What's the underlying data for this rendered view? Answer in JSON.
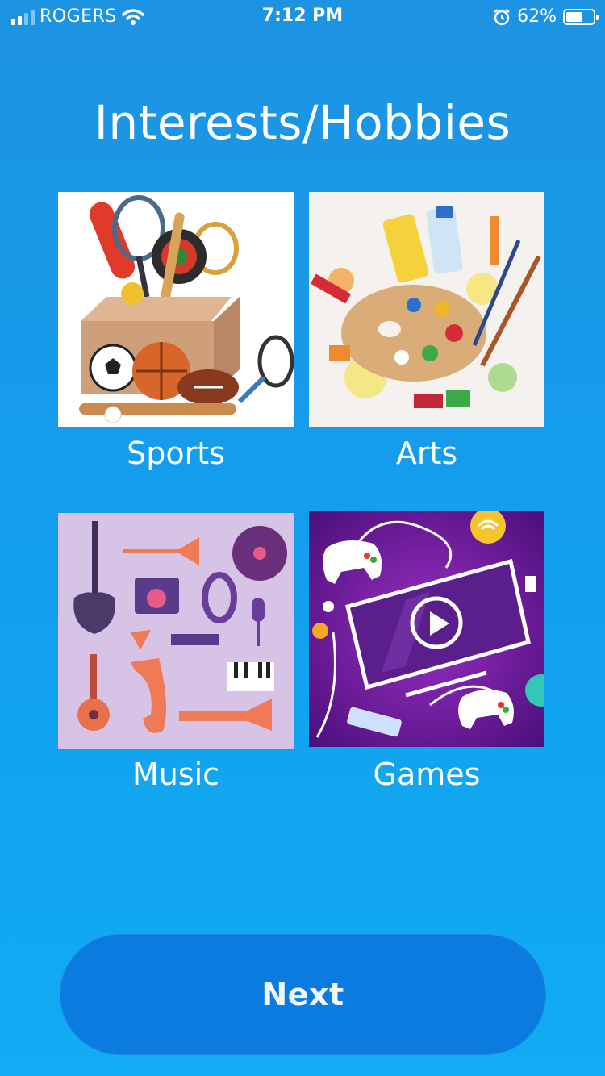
{
  "status_bar": {
    "carrier": "ROGERS",
    "time": "7:12 PM",
    "battery_percent": "62%",
    "battery_level": 0.62,
    "signal_bars": 2,
    "icons": [
      "signal-icon",
      "wifi-icon",
      "alarm-icon",
      "battery-icon"
    ]
  },
  "page": {
    "title": "Interests/Hobbies"
  },
  "categories": [
    {
      "label": "Sports",
      "icon": "sports-equipment-illustration"
    },
    {
      "label": "Arts",
      "icon": "art-palette-illustration"
    },
    {
      "label": "Music",
      "icon": "music-instruments-illustration"
    },
    {
      "label": "Games",
      "icon": "video-games-illustration"
    }
  ],
  "actions": {
    "next_label": "Next"
  },
  "colors": {
    "background": "#1596e6",
    "button": "#0c7be0",
    "text": "#ffffff"
  }
}
